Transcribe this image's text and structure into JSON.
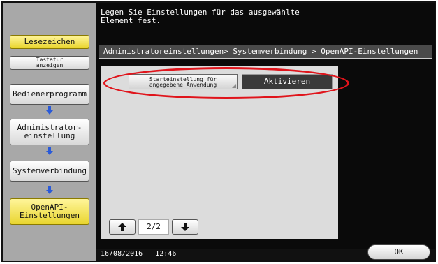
{
  "message": "Legen Sie Einstellungen für das ausgewählte\nElement fest.",
  "sidebar": {
    "bookmark_label": "Lesezeichen",
    "keyboard_label": "Tastatur\nanzeigen",
    "items": [
      {
        "label": "Bedienerprogramm"
      },
      {
        "label": "Administrator-\neinstellung"
      },
      {
        "label": "Systemverbindung"
      },
      {
        "label": "OpenAPI-\nEinstellungen"
      }
    ]
  },
  "breadcrumb": "Administratoreinstellungen> Systemverbindung > OpenAPI-Einstellungen",
  "buttons": {
    "start_setting": "Starteinstellung für\nangegebene Anwendung",
    "activate": "Aktivieren"
  },
  "pagination": {
    "up_icon": "up-arrow-icon",
    "down_icon": "down-arrow-icon",
    "page": "2/2"
  },
  "status": {
    "date": "16/08/2016",
    "time": "12:46"
  },
  "ok_label": "OK",
  "colors": {
    "highlight": "#e0141b",
    "active_sidebar": "#e9d52e",
    "arrow": "#2a5ad8"
  }
}
